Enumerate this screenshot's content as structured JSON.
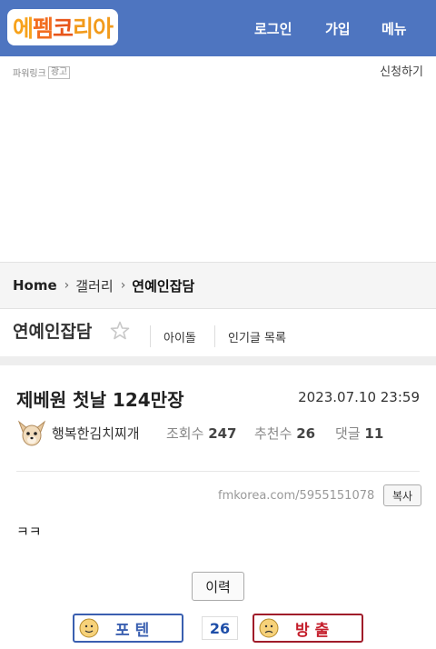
{
  "header": {
    "logo_chars": [
      "에",
      "펨",
      "코",
      "리아"
    ],
    "nav": {
      "login": "로그인",
      "join": "가입",
      "menu": "메뉴"
    },
    "colors": {
      "bar": "#4e75c0",
      "logo_orange": "#f26d1f"
    }
  },
  "ad": {
    "label": "파워링크",
    "badge": "광고",
    "apply": "신청하기"
  },
  "breadcrumb": {
    "home": "Home",
    "gallery": "갤러리",
    "current": "연예인잡담"
  },
  "board": {
    "title": "연예인잡담",
    "links": [
      "아이돌",
      "인기글 목록"
    ],
    "favorite_icon": "star-outline-icon"
  },
  "post": {
    "title": "제베원 첫날 124만장",
    "date": "2023.07.10 23:59",
    "author": "행복한김치찌개",
    "avatar_icon": "chihuahua-avatar-icon",
    "stats": {
      "views_label": "조회수",
      "views": "247",
      "recommend_label": "추천수",
      "recommend": "26",
      "comments_label": "댓글",
      "comments": "11"
    },
    "url": "fmkorea.com/5955151078",
    "copy_label": "복사",
    "body": "ㅋㅋ"
  },
  "actions": {
    "history_label": "이력",
    "upvote_label": "포텐",
    "upvote_count": "26",
    "downvote_label": "방출",
    "colors": {
      "up": "#3a5fb0",
      "down": "#c41d2a"
    }
  }
}
